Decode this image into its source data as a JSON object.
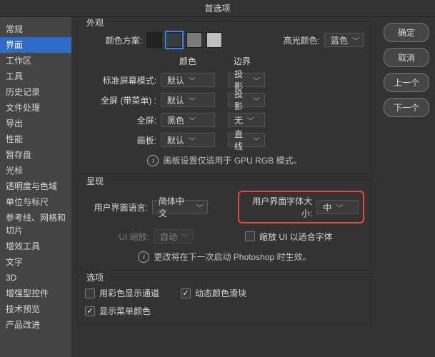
{
  "title": "首选项",
  "buttons": {
    "ok": "确定",
    "cancel": "取消",
    "prev": "上一个",
    "next": "下一个"
  },
  "sidebar": {
    "items": [
      "常规",
      "界面",
      "工作区",
      "工具",
      "历史记录",
      "文件处理",
      "导出",
      "性能",
      "暂存盘",
      "光标",
      "透明度与色域",
      "单位与标尺",
      "参考线、网格和切片",
      "增效工具",
      "文字",
      "3D",
      "增强型控件",
      "技术预览",
      "产品改进"
    ],
    "selectedIndex": 1
  },
  "appearance": {
    "title": "外观",
    "colorSchemeLabel": "颜色方案:",
    "swatches": [
      "#222222",
      "#3a3a3a",
      "#7a7a7a",
      "#bfbfbf"
    ],
    "swatchSelected": 1,
    "highlightLabel": "高光颜色:",
    "highlightValue": "蓝色",
    "headColor": "颜色",
    "headBorder": "边界",
    "rows": [
      {
        "label": "标准屏幕模式:",
        "col1": "默认",
        "col2": "投影"
      },
      {
        "label": "全屏 (带菜单) :",
        "col1": "默认",
        "col2": "投影"
      },
      {
        "label": "全屏:",
        "col1": "黑色",
        "col2": "无"
      },
      {
        "label": "画板:",
        "col1": "默认",
        "col2": "直线"
      }
    ],
    "note": "画板设置仅适用于 GPU RGB 模式。"
  },
  "render": {
    "title": "呈现",
    "langLabel": "用户界面语言:",
    "langValue": "简体中文",
    "fontSizeLabel": "用户界面字体大小:",
    "fontSizeValue": "中",
    "scaleLabel": "UI 缩放:",
    "scaleValue": "自动",
    "scaleCheck": "缩放 UI 以适合字体",
    "note": "更改将在下一次启动 Photoshop 时生效。"
  },
  "options": {
    "title": "选项",
    "colorChannels": "用彩色显示通道",
    "dynamicSliders": "动态颜色滑块",
    "showMenuColors": "显示菜单颜色"
  }
}
